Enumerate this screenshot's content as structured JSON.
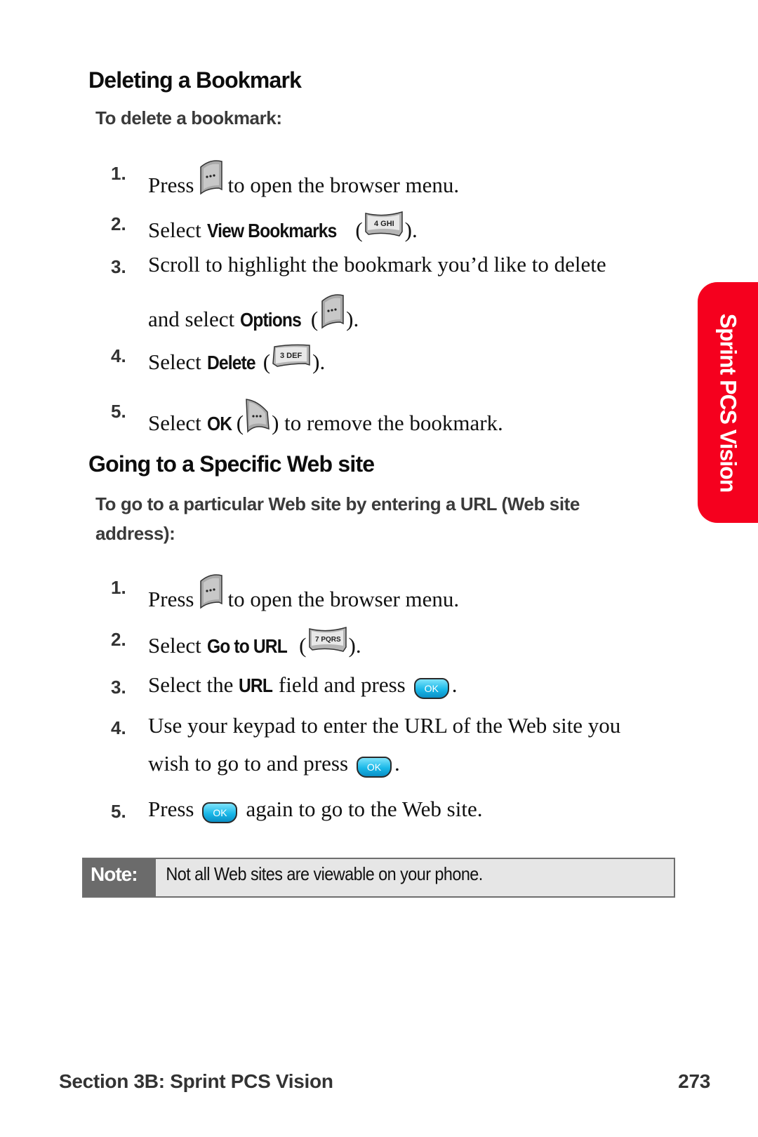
{
  "section1": {
    "title": "Deleting a Bookmark",
    "subtitle": "To delete a bookmark:",
    "steps": [
      {
        "num": "1.",
        "pre": "Press",
        "icon": "menu-softkey-icon",
        "post": "to open the browser menu."
      },
      {
        "num": "2.",
        "pre": "Select",
        "bold": "View Bookmarks",
        "open": "(",
        "key": "4 GHI",
        "close": ")."
      },
      {
        "num": "3.",
        "line1": "Scroll to highlight the bookmark you’d like to delete",
        "line2_pre": "and select",
        "bold": "Options",
        "open": "(",
        "icon": "options-softkey-icon",
        "close": ")."
      },
      {
        "num": "4.",
        "pre": "Select",
        "bold": "Delete",
        "open": "(",
        "key": "3 DEF",
        "close": ")."
      },
      {
        "num": "5.",
        "pre": "Select",
        "bold": "OK",
        "open": "(",
        "icon": "ok-softkey-icon",
        "close": ") to remove the bookmark."
      }
    ]
  },
  "section2": {
    "title": "Going to a Specific Web site",
    "subtitle_line1": "To go to a particular Web site by entering a URL (Web site",
    "subtitle_line2": "address):",
    "steps": [
      {
        "num": "1.",
        "pre": "Press",
        "icon": "menu-softkey-icon",
        "post": "to open the browser menu."
      },
      {
        "num": "2.",
        "pre": "Select",
        "bold": "Go to URL",
        "open": "(",
        "key": "7 PQRS",
        "close": ")."
      },
      {
        "num": "3.",
        "pre": "Select the",
        "bold": "URL",
        "mid": "field and press",
        "ok": "OK",
        "post": "."
      },
      {
        "num": "4.",
        "line1": "Use your keypad to enter the URL of the Web site you",
        "line2_pre": "wish to go to and press",
        "ok": "OK",
        "post": "."
      },
      {
        "num": "5.",
        "pre": "Press",
        "ok": "OK",
        "post": "again to go to the Web site."
      }
    ]
  },
  "note": {
    "label": "Note:",
    "text": "Not all Web sites are viewable on your phone."
  },
  "side_tab": {
    "label": "Sprint PCS Vision",
    "color": "#f5001e"
  },
  "footer": {
    "section": "Section 3B: Sprint PCS Vision",
    "page": "273"
  }
}
